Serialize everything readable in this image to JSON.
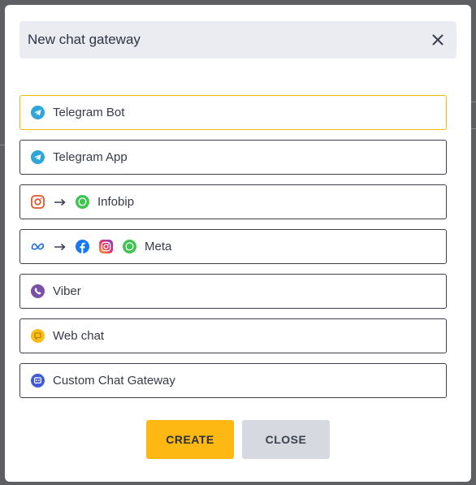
{
  "modal": {
    "title": "New chat gateway",
    "close_icon": "close-icon"
  },
  "options": [
    {
      "label": "Telegram Bot",
      "icons": [
        "telegram-icon"
      ],
      "selected": true
    },
    {
      "label": "Telegram App",
      "icons": [
        "telegram-icon"
      ],
      "selected": false
    },
    {
      "label": "Infobip",
      "icons": [
        "instagram-icon",
        "arrow-right-icon",
        "whatsapp-icon"
      ],
      "selected": false
    },
    {
      "label": "Meta",
      "icons": [
        "meta-icon",
        "arrow-right-icon",
        "facebook-icon",
        "instagram-icon",
        "whatsapp-icon"
      ],
      "selected": false
    },
    {
      "label": "Viber",
      "icons": [
        "viber-icon"
      ],
      "selected": false
    },
    {
      "label": "Web chat",
      "icons": [
        "web-chat-icon"
      ],
      "selected": false
    },
    {
      "label": "Custom Chat Gateway",
      "icons": [
        "custom-gateway-icon"
      ],
      "selected": false
    }
  ],
  "buttons": {
    "create_label": "CREATE",
    "close_label": "CLOSE"
  },
  "colors": {
    "accent": "#fdb813",
    "selected_border": "#f2b705",
    "header_bg": "#eaecf1",
    "secondary_button": "#d6d9e0"
  }
}
